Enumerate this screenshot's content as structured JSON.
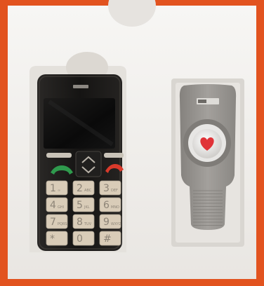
{
  "photo": {
    "frame_color": "#e2531f",
    "tray_color": "#f1efec",
    "phone": {
      "body_color": "#1b1a19",
      "screen_color": "#0d0d0d",
      "trim_color": "#9e9a92",
      "key_color": "#d9ccb8",
      "call_key_color": "#2f9a4d",
      "end_key_color": "#d93a2b",
      "keys": [
        {
          "main": "1",
          "sub": "∞"
        },
        {
          "main": "2",
          "sub": "ABC"
        },
        {
          "main": "3",
          "sub": "DEF"
        },
        {
          "main": "4",
          "sub": "GHI"
        },
        {
          "main": "5",
          "sub": "JKL"
        },
        {
          "main": "6",
          "sub": "MNO"
        },
        {
          "main": "7",
          "sub": "PQRS"
        },
        {
          "main": "8",
          "sub": "TUV"
        },
        {
          "main": "9",
          "sub": "WXYZ"
        },
        {
          "main": "*",
          "sub": ""
        },
        {
          "main": "0",
          "sub": ""
        },
        {
          "main": "#",
          "sub": ""
        }
      ]
    },
    "pendant": {
      "body_color": "#9b9894",
      "ring_color": "#e7e6e4",
      "button_color": "#f2f1ef",
      "heart_color": "#e03338"
    }
  }
}
